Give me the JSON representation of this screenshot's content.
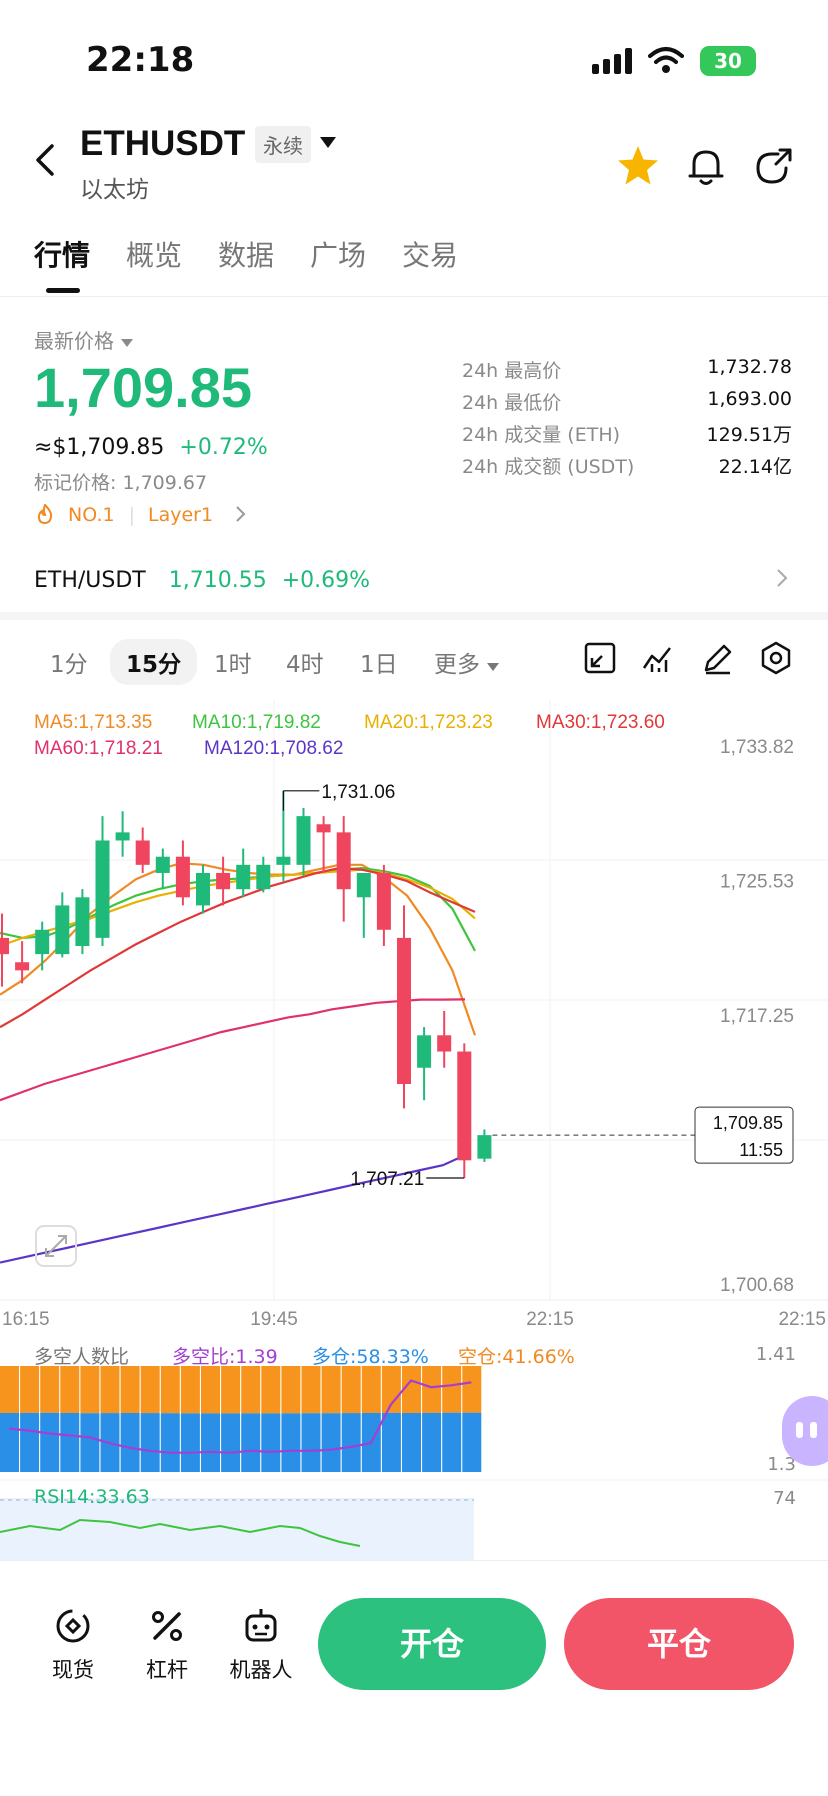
{
  "status_bar": {
    "time": "22:18",
    "battery": "30"
  },
  "header": {
    "symbol": "ETHUSDT",
    "contract_type": "永续",
    "coin_name": "以太坊",
    "icons": [
      "back-icon",
      "star-icon",
      "bell-icon",
      "share-icon"
    ],
    "star_color": "#f7b500"
  },
  "tabs": [
    {
      "label": "行情",
      "active": true
    },
    {
      "label": "概览"
    },
    {
      "label": "数据"
    },
    {
      "label": "广场"
    },
    {
      "label": "交易"
    }
  ],
  "price": {
    "label": "最新价格",
    "last": "1,709.85",
    "usd": "≈$1,709.85",
    "change": "+0.72%",
    "mark": "标记价格: 1,709.67",
    "tag_rank": "NO.1",
    "tag_category": "Layer1"
  },
  "stats": [
    {
      "label": "24h 最高价",
      "value": "1,732.78"
    },
    {
      "label": "24h 最低价",
      "value": "1,693.00"
    },
    {
      "label": "24h 成交量 (ETH)",
      "value": "129.51万"
    },
    {
      "label": "24h 成交额 (USDT)",
      "value": "22.14亿"
    }
  ],
  "spot_pair": {
    "name": "ETH/USDT",
    "price": "1,710.55",
    "change": "+0.69%"
  },
  "intervals": [
    {
      "label": "1分"
    },
    {
      "label": "15分",
      "active": true
    },
    {
      "label": "1时"
    },
    {
      "label": "4时"
    },
    {
      "label": "1日"
    },
    {
      "label": "更多"
    }
  ],
  "chart_tools": [
    "fullscreen-icon",
    "indicator-icon",
    "draw-icon",
    "settings-icon"
  ],
  "chart_data": {
    "type": "candlestick",
    "interval": "15分",
    "ma_legend": [
      {
        "name": "MA5:1,713.35",
        "color": "#f08a24"
      },
      {
        "name": "MA10:1,719.82",
        "color": "#3ec43e"
      },
      {
        "name": "MA20:1,723.23",
        "color": "#e8b100"
      },
      {
        "name": "MA30:1,723.60",
        "color": "#e03838"
      },
      {
        "name": "MA60:1,718.21",
        "color": "#e0306e"
      },
      {
        "name": "MA120:1,708.62",
        "color": "#5b35c8"
      }
    ],
    "y_ticks": [
      "1,733.82",
      "1,725.53",
      "1,717.25",
      "1,700.68"
    ],
    "ylim": [
      1700.68,
      1733.82
    ],
    "x_ticks": [
      "16:15",
      "19:45",
      "22:15",
      "22:15"
    ],
    "high_marker": "1,731.06",
    "low_marker": "1,707.21",
    "current_price": "1,709.85",
    "countdown": "11:55",
    "candles": [
      [
        1722.0,
        1723.5,
        1719.0,
        1721.0
      ],
      [
        1720.5,
        1721.8,
        1719.2,
        1720.0
      ],
      [
        1721.0,
        1723.0,
        1720.0,
        1722.5
      ],
      [
        1721.0,
        1724.8,
        1720.8,
        1724.0
      ],
      [
        1721.5,
        1725.0,
        1721.0,
        1724.5
      ],
      [
        1722.0,
        1729.5,
        1721.5,
        1728.0
      ],
      [
        1728.0,
        1729.8,
        1727.0,
        1728.5
      ],
      [
        1728.0,
        1728.8,
        1726.0,
        1726.5
      ],
      [
        1726.0,
        1727.5,
        1725.0,
        1727.0
      ],
      [
        1727.0,
        1728.0,
        1724.0,
        1724.5
      ],
      [
        1724.0,
        1726.5,
        1723.5,
        1726.0
      ],
      [
        1726.0,
        1727.0,
        1724.0,
        1725.0
      ],
      [
        1725.0,
        1727.5,
        1724.5,
        1726.5
      ],
      [
        1725.0,
        1727.0,
        1724.8,
        1726.5
      ],
      [
        1726.5,
        1731.06,
        1725.5,
        1727.0
      ],
      [
        1726.5,
        1730.0,
        1725.8,
        1729.5
      ],
      [
        1729.0,
        1729.5,
        1726.0,
        1728.5
      ],
      [
        1728.5,
        1729.5,
        1723.0,
        1725.0
      ],
      [
        1724.5,
        1726.0,
        1722.0,
        1726.0
      ],
      [
        1726.0,
        1726.5,
        1721.5,
        1722.5
      ],
      [
        1722.0,
        1724.0,
        1711.5,
        1713.0
      ],
      [
        1714.0,
        1716.5,
        1712.0,
        1716.0
      ],
      [
        1716.0,
        1717.5,
        1714.0,
        1715.0
      ],
      [
        1715.0,
        1715.5,
        1707.21,
        1708.3
      ],
      [
        1708.4,
        1710.2,
        1708.2,
        1709.85
      ]
    ],
    "ma_lines": {
      "MA5": [
        1718.5,
        1719.4,
        1720.6,
        1722.0,
        1723.5,
        1724.6,
        1725.6,
        1726.2,
        1726.6,
        1726.5,
        1726.2,
        1726.0,
        1725.9,
        1725.9,
        1726.2,
        1726.5,
        1726.5,
        1725.7,
        1724.6,
        1722.6,
        1720.0,
        1716.0
      ],
      "MA10": [
        1722.3,
        1722.0,
        1722.1,
        1722.6,
        1723.3,
        1724.0,
        1724.6,
        1725.0,
        1725.3,
        1725.5,
        1725.6,
        1725.7,
        1725.8,
        1725.9,
        1726.0,
        1726.2,
        1726.3,
        1726.1,
        1725.8,
        1725.2,
        1723.8,
        1721.2
      ],
      "MA20": [
        1721.5,
        1722.0,
        1722.4,
        1722.8,
        1723.2,
        1723.7,
        1724.2,
        1724.6,
        1724.9,
        1725.2,
        1725.4,
        1725.6,
        1725.8,
        1725.9,
        1726.0,
        1726.1,
        1726.2,
        1726.0,
        1725.6,
        1725.1,
        1724.4,
        1723.2
      ],
      "MA30": [
        1716.5,
        1717.3,
        1718.2,
        1719.1,
        1720.0,
        1720.8,
        1721.6,
        1722.3,
        1723.0,
        1723.6,
        1724.2,
        1724.7,
        1725.2,
        1725.6,
        1726.0,
        1726.3,
        1726.2,
        1725.9,
        1725.5,
        1724.8,
        1724.2,
        1723.6
      ],
      "MA60": [
        1712.0,
        1712.5,
        1713.0,
        1713.4,
        1713.8,
        1714.2,
        1714.6,
        1715.0,
        1715.4,
        1715.8,
        1716.2,
        1716.5,
        1716.8,
        1717.1,
        1717.3,
        1717.6,
        1717.8,
        1718.0,
        1718.1,
        1718.2,
        1718.2,
        1718.21
      ],
      "MA120": [
        1702.0,
        1702.3,
        1702.6,
        1702.9,
        1703.2,
        1703.5,
        1703.8,
        1704.1,
        1704.4,
        1704.7,
        1705.0,
        1705.3,
        1705.6,
        1705.9,
        1706.2,
        1706.5,
        1706.8,
        1707.1,
        1707.4,
        1707.7,
        1708.0,
        1708.62
      ]
    }
  },
  "long_short": {
    "title": "多空人数比",
    "ratio": "多空比:1.39",
    "long": "多仓:58.33%",
    "short": "空仓:41.66%",
    "axis_top": "1.41",
    "axis_bottom": "1.3",
    "long_pct": [
      58.0,
      58.1,
      58.2,
      58.0,
      57.8,
      57.9,
      58.0,
      57.9,
      57.8,
      57.7,
      57.6,
      57.6,
      57.7,
      57.6,
      57.7,
      57.8,
      57.8,
      57.9,
      58.0,
      58.1,
      58.0,
      58.1,
      58.3,
      58.33
    ],
    "ratio_series": [
      1.345,
      1.343,
      1.34,
      1.338,
      1.336,
      1.33,
      1.325,
      1.322,
      1.32,
      1.32,
      1.321,
      1.32,
      1.322,
      1.321,
      1.322,
      1.322,
      1.323,
      1.326,
      1.33,
      1.37,
      1.395,
      1.388,
      1.39,
      1.393
    ],
    "long_color": "#2a8fe6",
    "short_color": "#f7941d"
  },
  "rsi": {
    "label": "RSI14:33.63",
    "axis": "74"
  },
  "bottom_nav": [
    {
      "label": "现货",
      "icon": "spot-icon"
    },
    {
      "label": "杠杆",
      "icon": "leverage-icon"
    },
    {
      "label": "机器人",
      "icon": "robot-icon"
    }
  ],
  "actions": {
    "open": "开仓",
    "close": "平仓"
  }
}
